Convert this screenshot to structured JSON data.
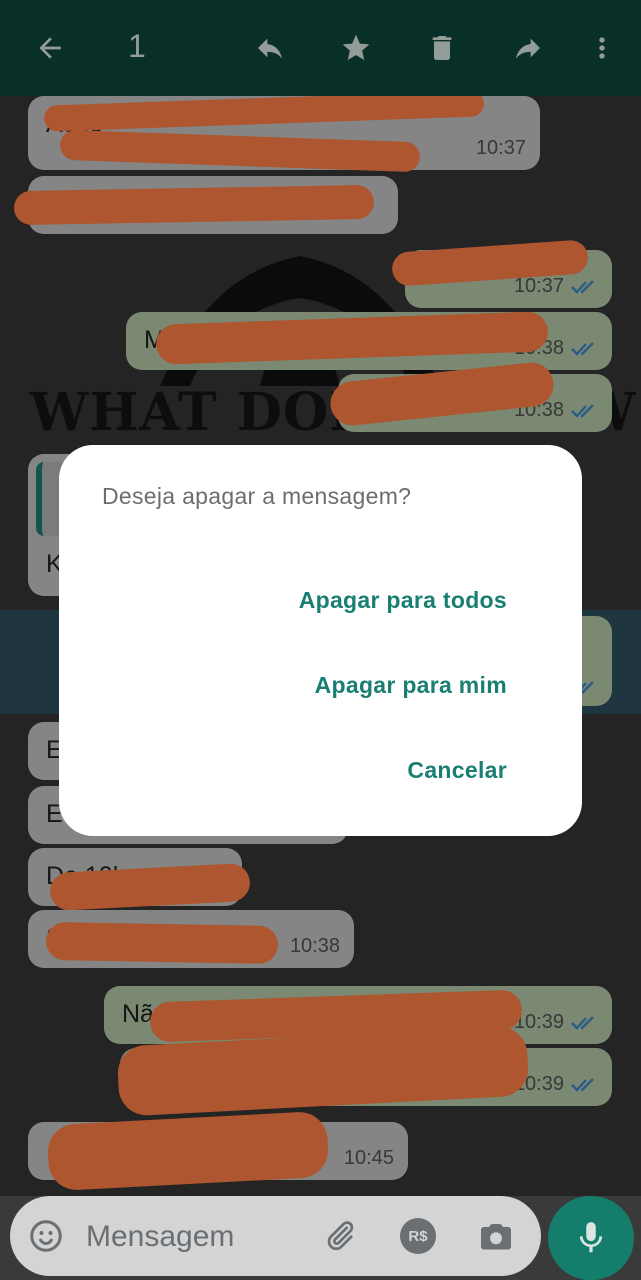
{
  "toolbar": {
    "selected_count": "1",
    "icons": [
      "back-arrow-icon",
      "reply-icon",
      "star-icon",
      "delete-icon",
      "forward-icon",
      "more-vert-icon"
    ]
  },
  "watermark": {
    "text": "WHAT DOES A NEW YOU"
  },
  "messages": [
    {
      "side": "in",
      "text": "Acho",
      "time": "10:37"
    },
    {
      "side": "in",
      "text": "",
      "time": ""
    },
    {
      "side": "out",
      "text": "",
      "time": "10:37"
    },
    {
      "side": "out",
      "text": "M",
      "time": "10:38"
    },
    {
      "side": "out",
      "text": "",
      "time": "10:38"
    },
    {
      "side": "in",
      "text": "K",
      "time": ""
    },
    {
      "side": "in",
      "text": "E",
      "time": ""
    },
    {
      "side": "in",
      "text": "E",
      "time": ""
    },
    {
      "side": "in",
      "text": "De 10kg",
      "time": ""
    },
    {
      "side": "in",
      "text": "Só",
      "time": "10:38"
    },
    {
      "side": "out",
      "text": "Não",
      "time": "10:39"
    },
    {
      "side": "out",
      "text": "?",
      "time": "10:39"
    },
    {
      "side": "in",
      "text": "",
      "time": "10:45"
    }
  ],
  "dialog": {
    "title": "Deseja apagar a mensagem?",
    "delete_for_everyone": "Apagar para todos",
    "delete_for_me": "Apagar para mim",
    "cancel": "Cancelar"
  },
  "input": {
    "placeholder": "Mensagem",
    "payment_label": "R$"
  },
  "colors": {
    "toolbar": "#0c473d",
    "accent": "#1a7f73",
    "redaction": "#ff7f46",
    "read_ticks": "#3d86c7",
    "incoming_bubble": "#c5c5c5",
    "outgoing_bubble": "#b5c9a8"
  }
}
